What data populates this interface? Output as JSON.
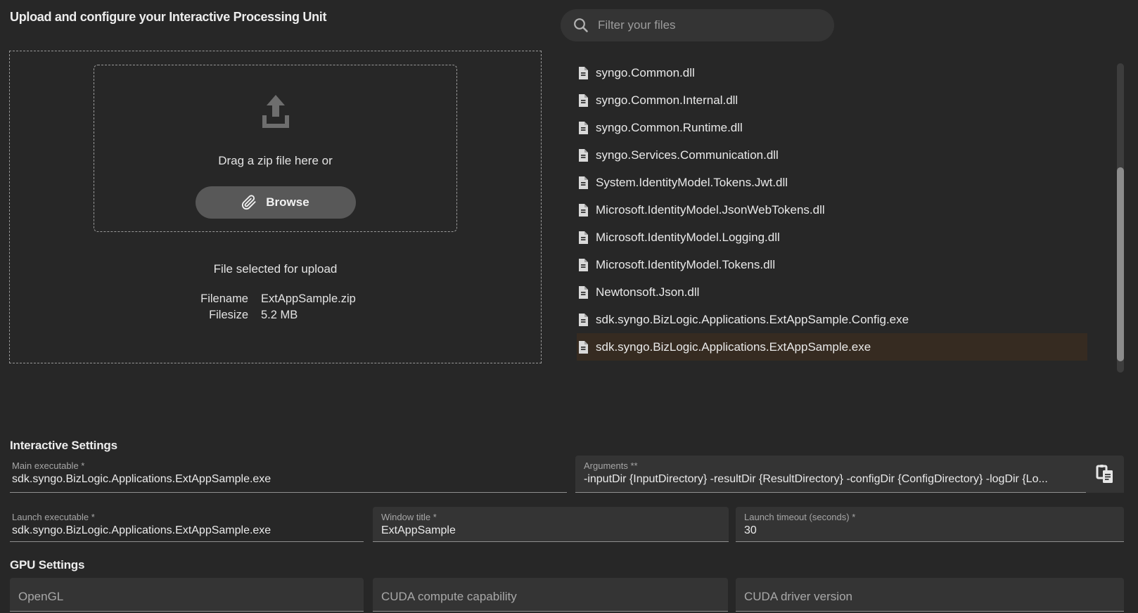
{
  "title": "Upload and configure your Interactive Processing Unit",
  "filter": {
    "placeholder": "Filter your files"
  },
  "upload": {
    "drag_text": "Drag a zip file here or",
    "browse_label": "Browse",
    "selected_heading": "File selected for upload",
    "file_info": {
      "filename_label": "Filename",
      "filename": "ExtAppSample.zip",
      "filesize_label": "Filesize",
      "filesize": "5.2 MB"
    }
  },
  "file_list": {
    "items": [
      {
        "name": "syngo.Common.dll",
        "selected": false
      },
      {
        "name": "syngo.Common.Internal.dll",
        "selected": false
      },
      {
        "name": "syngo.Common.Runtime.dll",
        "selected": false
      },
      {
        "name": "syngo.Services.Communication.dll",
        "selected": false
      },
      {
        "name": "System.IdentityModel.Tokens.Jwt.dll",
        "selected": false
      },
      {
        "name": "Microsoft.IdentityModel.JsonWebTokens.dll",
        "selected": false
      },
      {
        "name": "Microsoft.IdentityModel.Logging.dll",
        "selected": false
      },
      {
        "name": "Microsoft.IdentityModel.Tokens.dll",
        "selected": false
      },
      {
        "name": "Newtonsoft.Json.dll",
        "selected": false
      },
      {
        "name": "sdk.syngo.BizLogic.Applications.ExtAppSample.Config.exe",
        "selected": false
      },
      {
        "name": "sdk.syngo.BizLogic.Applications.ExtAppSample.exe",
        "selected": true
      }
    ]
  },
  "interactive_settings": {
    "heading": "Interactive Settings",
    "main_executable": {
      "label": "Main executable *",
      "value": "sdk.syngo.BizLogic.Applications.ExtAppSample.exe"
    },
    "arguments": {
      "label": "Arguments **",
      "value": "-inputDir {InputDirectory} -resultDir {ResultDirectory} -configDir {ConfigDirectory} -logDir {Lo..."
    },
    "launch_executable": {
      "label": "Launch executable *",
      "value": "sdk.syngo.BizLogic.Applications.ExtAppSample.exe"
    },
    "window_title": {
      "label": "Window title *",
      "value": "ExtAppSample"
    },
    "launch_timeout": {
      "label": "Launch timeout (seconds) *",
      "value": "30"
    }
  },
  "gpu_settings": {
    "heading": "GPU Settings",
    "opengl": {
      "label": "OpenGL",
      "value": ""
    },
    "cuda_compute_capability": {
      "label": "CUDA compute capability",
      "value": ""
    },
    "cuda_driver_version": {
      "label": "CUDA driver version",
      "value": ""
    }
  },
  "colors": {
    "page_bg": "#272727",
    "panel_field_bg": "#343434",
    "browse_button_bg": "#585858",
    "selected_row_bg": "#362b21",
    "primary_text": "#ececec",
    "label_text": "#a6a6a6",
    "underline": "#8f8f8f",
    "dashed_border": "#999999",
    "scrollbar_thumb": "#8c8c8c"
  }
}
